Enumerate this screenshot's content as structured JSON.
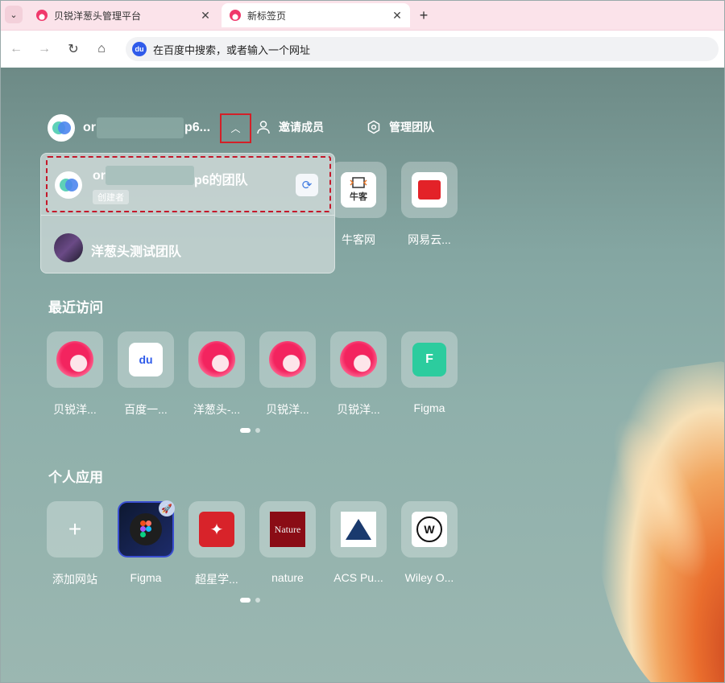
{
  "browser": {
    "tabs": [
      {
        "label": "贝锐洋葱头管理平台",
        "active": false
      },
      {
        "label": "新标签页",
        "active": true
      }
    ],
    "address_placeholder": "在百度中搜索，或者输入一个网址",
    "icons": {
      "menu": "chevron-down-icon",
      "close": "close-icon",
      "new_tab": "plus-icon",
      "back": "arrow-left-icon",
      "forward": "arrow-right-icon",
      "reload": "reload-icon",
      "home": "home-icon",
      "search_engine": "baidu-icon"
    }
  },
  "team": {
    "current_name_start": "or",
    "current_name_end": "p6...",
    "invite_label": "邀请成员",
    "manage_label": "管理团队"
  },
  "team_dropdown": {
    "items": [
      {
        "name_start": "or",
        "name_end": "p6的团队",
        "role": "创建者"
      },
      {
        "name": "洋葱头测试团队"
      }
    ]
  },
  "top_shortcuts": [
    {
      "label": "牛客网",
      "icon_text": "牛客"
    },
    {
      "label": "网易云..."
    }
  ],
  "recent": {
    "title": "最近访问",
    "items": [
      {
        "label": "贝锐洋..."
      },
      {
        "label": "百度一...",
        "icon_text": "du"
      },
      {
        "label": "洋葱头-..."
      },
      {
        "label": "贝锐洋..."
      },
      {
        "label": "贝锐洋..."
      },
      {
        "label": "Figma",
        "icon_text": "F"
      }
    ]
  },
  "personal": {
    "title": "个人应用",
    "items": [
      {
        "label": "添加网站",
        "icon_text": "+"
      },
      {
        "label": "Figma"
      },
      {
        "label": "超星学..."
      },
      {
        "label": "nature",
        "icon_text": "Nature"
      },
      {
        "label": "ACS Pu..."
      },
      {
        "label": "Wiley O...",
        "icon_text": "W"
      }
    ]
  },
  "colors": {
    "highlight": "#d32028",
    "accent_pink": "#f0386b",
    "page_bg": "#84a6a2"
  }
}
